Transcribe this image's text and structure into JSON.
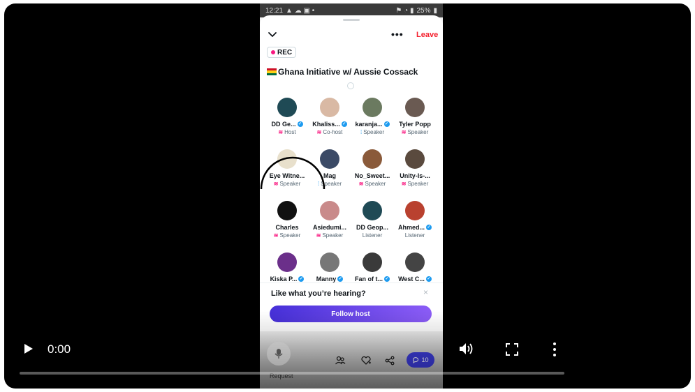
{
  "status_bar": {
    "time": "12:21",
    "battery": "25%"
  },
  "space": {
    "more_label": "•••",
    "leave_label": "Leave",
    "rec_label": "REC",
    "title": "Ghana Initiative w/ Aussie Cossack"
  },
  "participants": [
    {
      "name": "DD Ge...",
      "role": "Host",
      "verified": true,
      "role_icon": "spark",
      "color": "#1f4a55"
    },
    {
      "name": "Khaliss...",
      "role": "Co-host",
      "verified": true,
      "role_icon": "spark",
      "color": "#d9b9a4"
    },
    {
      "name": "karanja...",
      "role": "Speaker",
      "verified": true,
      "role_icon": "bars",
      "color": "#6b7a60"
    },
    {
      "name": "Tyler Popp",
      "role": "Speaker",
      "verified": false,
      "role_icon": "spark",
      "color": "#6a5a52"
    },
    {
      "name": "Eye Witne...",
      "role": "Speaker",
      "verified": false,
      "role_icon": "spark",
      "color": "#e8e0cc"
    },
    {
      "name": "Mag",
      "role": "Speaker",
      "verified": false,
      "role_icon": "bars",
      "color": "#3b4a66"
    },
    {
      "name": "No_Sweet...",
      "role": "Speaker",
      "verified": false,
      "role_icon": "spark",
      "color": "#8a5a3a"
    },
    {
      "name": "Unity-Is-...",
      "role": "Speaker",
      "verified": false,
      "role_icon": "spark",
      "color": "#5a4a3e"
    },
    {
      "name": "Charles",
      "role": "Speaker",
      "verified": false,
      "role_icon": "spark",
      "color": "#111111"
    },
    {
      "name": "Asiedumi...",
      "role": "Speaker",
      "verified": false,
      "role_icon": "spark",
      "color": "#c98a8a"
    },
    {
      "name": "DD Geop...",
      "role": "Listener",
      "verified": false,
      "role_icon": "none",
      "color": "#1f4a55"
    },
    {
      "name": "Ahmed...",
      "role": "Listener",
      "verified": true,
      "role_icon": "none",
      "color": "#b9412f"
    },
    {
      "name": "Kiska P...",
      "role": "",
      "verified": true,
      "role_icon": "none",
      "color": "#6b2f8a"
    },
    {
      "name": "Manny",
      "role": "",
      "verified": true,
      "role_icon": "none",
      "color": "#777777"
    },
    {
      "name": "Fan of t...",
      "role": "",
      "verified": true,
      "role_icon": "none",
      "color": "#3a3a3a"
    },
    {
      "name": "West C...",
      "role": "",
      "verified": true,
      "role_icon": "none",
      "color": "#444444"
    }
  ],
  "follow_popup": {
    "title": "Like what you’re hearing?",
    "close": "×",
    "button": "Follow host"
  },
  "bottom_bar": {
    "request_label": "Request",
    "comment_count": "10"
  },
  "video": {
    "time": "0:00",
    "progress": 0
  }
}
